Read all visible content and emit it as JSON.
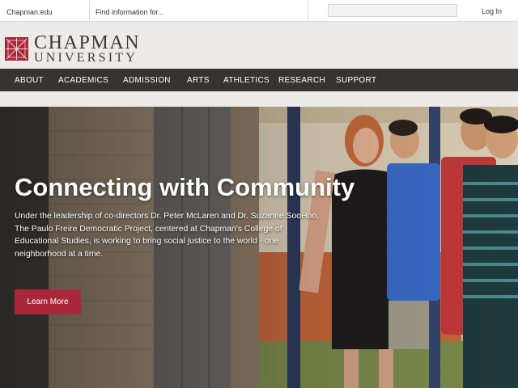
{
  "utility": {
    "home_link": "Chapman.edu",
    "find_label": "Find information for...",
    "search_placeholder": "",
    "login": "Log In"
  },
  "brand": {
    "name_line1": "CHAPMAN",
    "name_line2": "UNIVERSITY",
    "mark_color": "#a8273a"
  },
  "nav": {
    "items": [
      {
        "label": "ABOUT"
      },
      {
        "label": "ACADEMICS"
      },
      {
        "label": "ADMISSION"
      },
      {
        "label": "ARTS"
      },
      {
        "label": "ATHLETICS"
      },
      {
        "label": "RESEARCH"
      },
      {
        "label": "SUPPORT"
      }
    ]
  },
  "hero": {
    "title": "Connecting with Community",
    "description": "Under the leadership of co-directors Dr. Peter McLaren and Dr. Suzanne SooHoo, The Paulo Freire Democratic Project, centered at Chapman's College of Educational Studies, is working to bring social justice to the world - one neighborhood at a time.",
    "button": "Learn More",
    "button_color": "#a8273a"
  }
}
